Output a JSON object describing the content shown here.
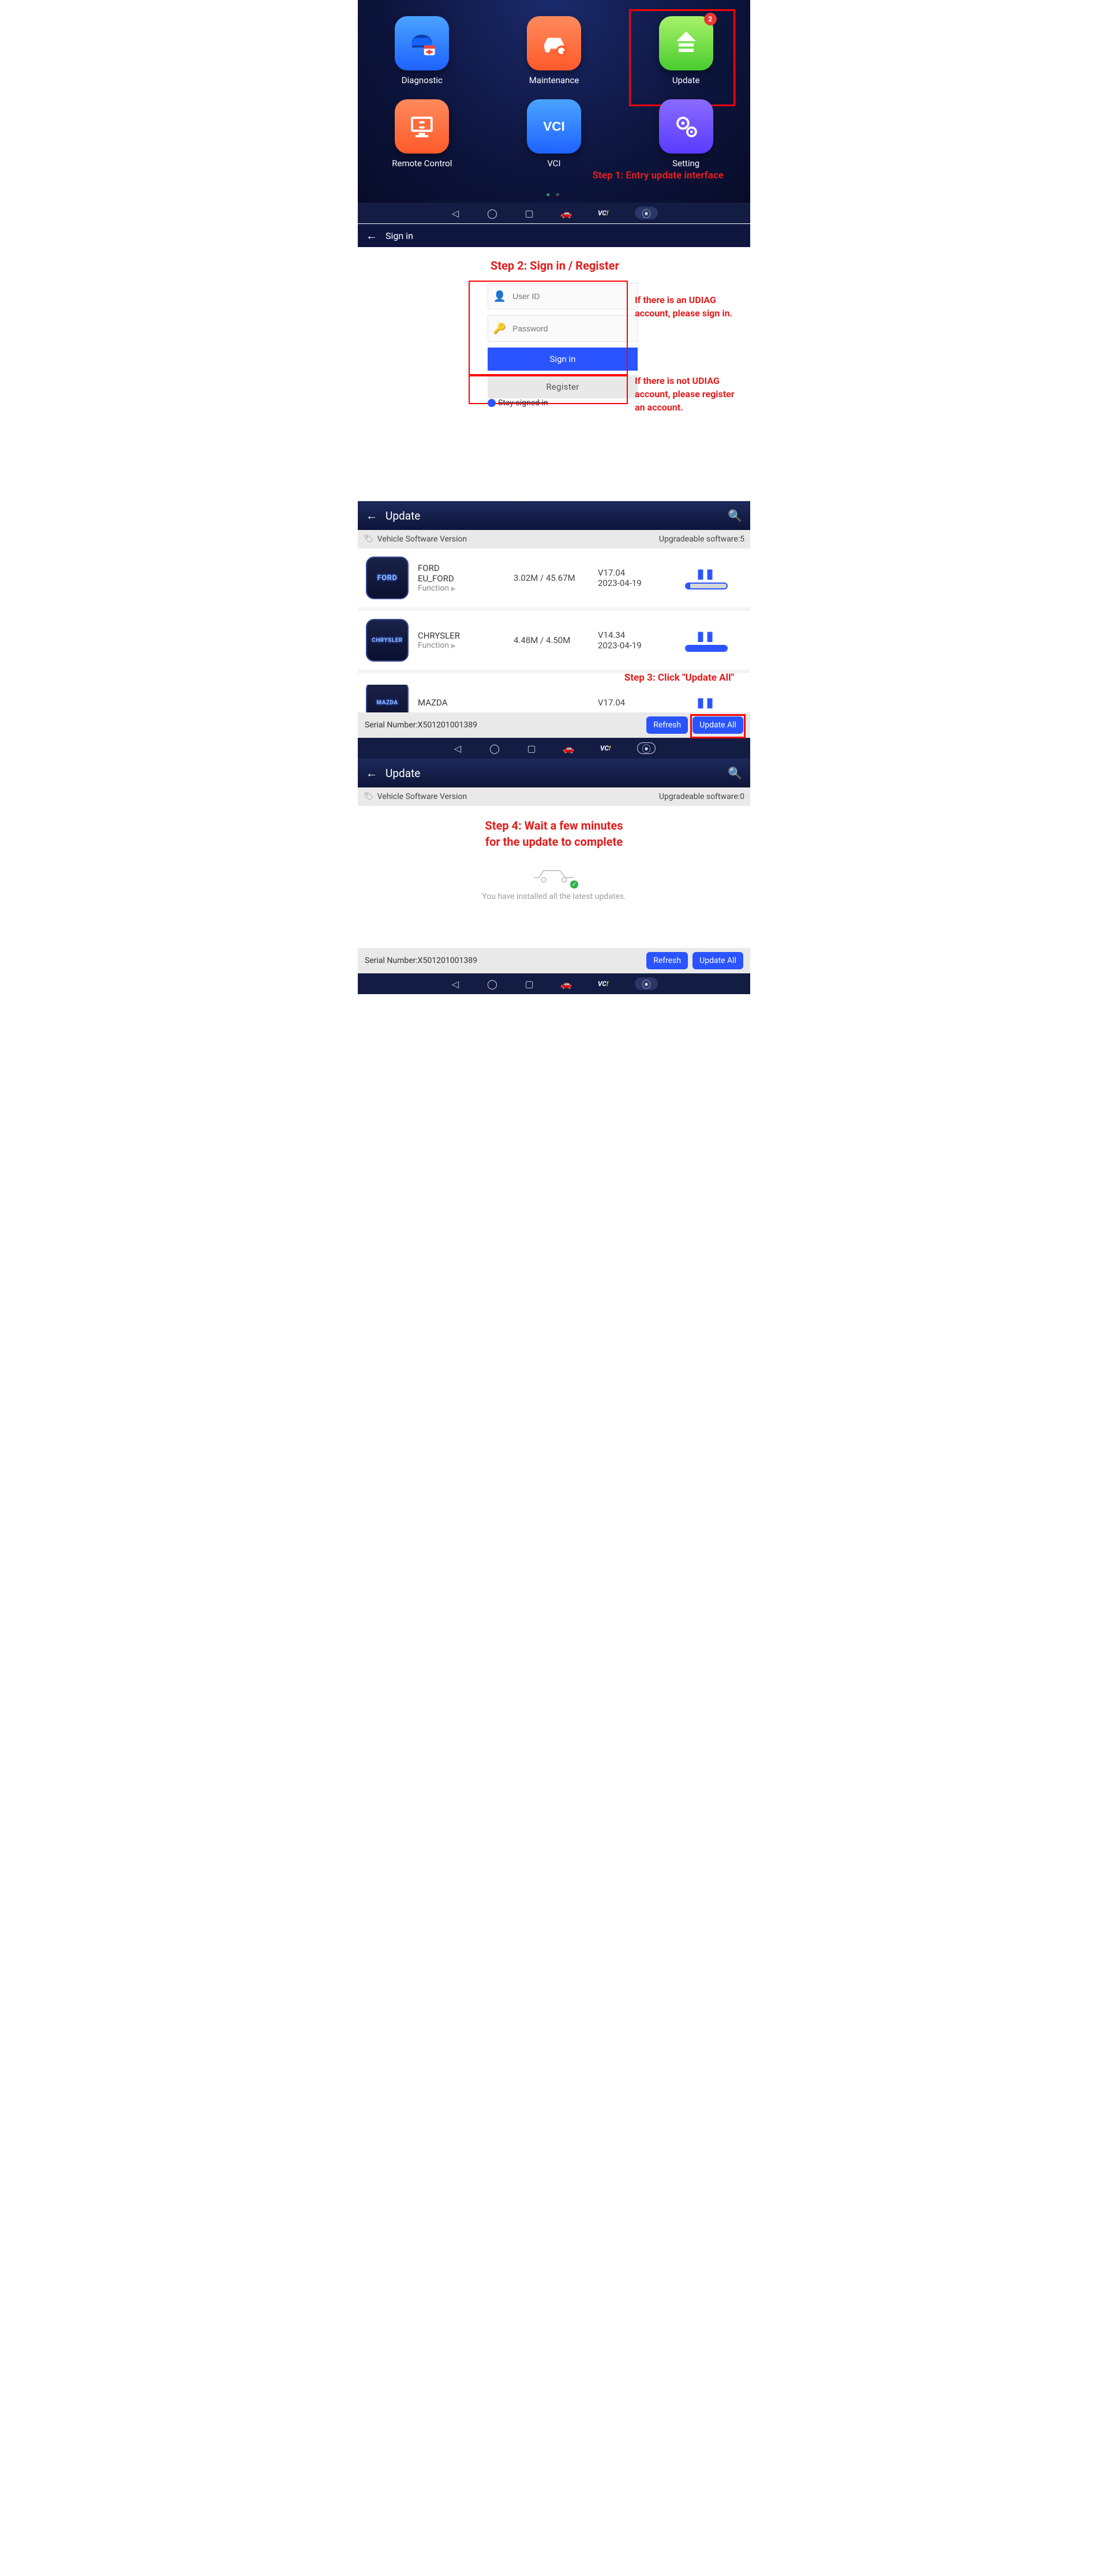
{
  "screen1": {
    "apps": {
      "diagnostic": "Diagnostic",
      "maintenance": "Maintenance",
      "update": "Update",
      "remote": "Remote Control",
      "vci": "VCI",
      "setting": "Setting"
    },
    "update_badge": "2",
    "step_label": "Step 1: Entry update interface"
  },
  "screen2": {
    "header": "Sign in",
    "title": "Step 2: Sign in / Register",
    "user_id_ph": "User ID",
    "password_ph": "Password",
    "signin_btn": "Sign in",
    "register_btn": "Register",
    "stay": "Stay signed in",
    "note_signin": "If there is an UDIAG account, please sign in.",
    "note_register": "If there is not UDIAG account, please register an account."
  },
  "screen3": {
    "title": "Update",
    "subheader_left": "Vehicle Software Version",
    "subheader_right": "Upgradeable software:5",
    "rows": [
      {
        "brand_logo": "FORD",
        "name1": "FORD",
        "name2": "EU_FORD",
        "fn": "Function",
        "size": "3.02M / 45.67M",
        "ver": "V17.04",
        "date": "2023-04-19",
        "progress": 10
      },
      {
        "brand_logo": "CHRYSLER",
        "name1": "CHRYSLER",
        "name2": "",
        "fn": "Function",
        "size": "4.48M / 4.50M",
        "ver": "V14.34",
        "date": "2023-04-19",
        "progress": 100
      },
      {
        "brand_logo": "MAZDA",
        "name1": "MAZDA",
        "name2": "",
        "fn": "",
        "size": "",
        "ver": "V17.04",
        "date": "",
        "progress": 0
      }
    ],
    "step_label": "Step 3: Click \"Update All\"",
    "serial_label": "Serial Number:",
    "serial": "X501201001389",
    "refresh": "Refresh",
    "update_all": "Update All"
  },
  "screen4": {
    "title": "Update",
    "subheader_left": "Vehicle Software Version",
    "subheader_right": "Upgradeable software:0",
    "step_label_l1": "Step 4: Wait a few minutes",
    "step_label_l2": "for the update to complete",
    "done": "You have installed all the latest updates.",
    "serial_label": "Serial Number:",
    "serial": "X501201001389",
    "refresh": "Refresh",
    "update_all": "Update All"
  },
  "nav": {
    "vci": "VC",
    "vcidot": "!"
  }
}
